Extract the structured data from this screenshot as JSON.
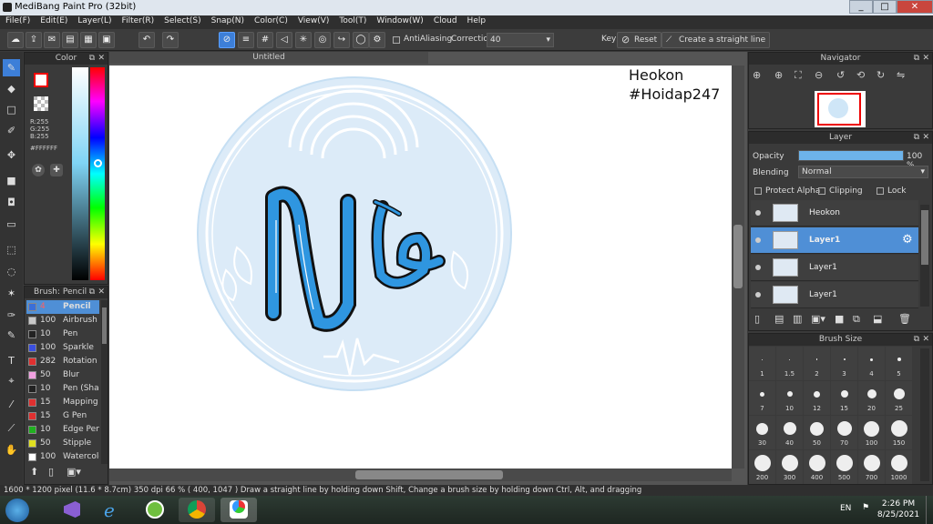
{
  "window": {
    "title": "MediBang Paint Pro (32bit)",
    "min": "_",
    "max": "□",
    "close": "✕"
  },
  "menu": [
    "File(F)",
    "Edit(E)",
    "Layer(L)",
    "Filter(R)",
    "Select(S)",
    "Snap(N)",
    "Color(C)",
    "View(V)",
    "Tool(T)",
    "Window(W)",
    "Cloud",
    "Help"
  ],
  "toolbar": {
    "antialiasing_label": "AntiAliasing",
    "correction_label": "Correction",
    "correction_value": "40",
    "key_label": "Key",
    "reset_label": "Reset",
    "straight_line_label": "Create a straight line"
  },
  "color_panel": {
    "title": "Color",
    "r": "R:255",
    "g": "G:255",
    "b": "B:255",
    "hex": "#FFFFFF"
  },
  "brush_panel": {
    "title": "Brush: Pencil",
    "items": [
      {
        "size": "4",
        "name": "Pencil",
        "color": "#3a6fd8"
      },
      {
        "size": "100",
        "name": "Airbrush",
        "color": "#c8c8c8"
      },
      {
        "size": "10",
        "name": "Pen",
        "color": "#222222"
      },
      {
        "size": "100",
        "name": "Sparkle",
        "color": "#3a4fe0"
      },
      {
        "size": "282",
        "name": "Rotation",
        "color": "#e03030"
      },
      {
        "size": "50",
        "name": "Blur",
        "color": "#f0a0e0"
      },
      {
        "size": "10",
        "name": "Pen (Sharp)",
        "color": "#222222"
      },
      {
        "size": "15",
        "name": "Mapping",
        "color": "#e03030"
      },
      {
        "size": "15",
        "name": "G Pen",
        "color": "#e03030"
      },
      {
        "size": "10",
        "name": "Edge Pen",
        "color": "#20b020"
      },
      {
        "size": "50",
        "name": "Stipple",
        "color": "#e0e020"
      },
      {
        "size": "100",
        "name": "Watercolor",
        "color": "#ffffff"
      }
    ]
  },
  "document": {
    "tab": "Untitled",
    "text_line1": "Heokon",
    "text_line2": "#Hoidap247"
  },
  "navigator": {
    "title": "Navigator"
  },
  "layer_panel": {
    "title": "Layer",
    "opacity_label": "Opacity",
    "opacity_value": "100 %",
    "blending_label": "Blending",
    "blending_value": "Normal",
    "protect_alpha": "Protect Alpha",
    "clipping": "Clipping",
    "lock": "Lock",
    "layers": [
      {
        "name": "Heokon",
        "selected": false
      },
      {
        "name": "Layer1",
        "selected": true
      },
      {
        "name": "Layer1",
        "selected": false
      },
      {
        "name": "Layer1",
        "selected": false
      }
    ]
  },
  "brush_size_panel": {
    "title": "Brush Size",
    "sizes": [
      "1",
      "1.5",
      "2",
      "3",
      "4",
      "5",
      "7",
      "10",
      "12",
      "15",
      "20",
      "25",
      "30",
      "40",
      "50",
      "70",
      "100",
      "150",
      "200",
      "300",
      "400",
      "500",
      "700",
      "1000"
    ]
  },
  "status": {
    "text": "1600 * 1200 pixel   (11.6 * 8.7cm)   350 dpi   66 %   ( 400, 1047 )   Draw a straight line by holding down Shift, Change a brush size by holding down Ctrl, Alt, and dragging"
  },
  "taskbar": {
    "lang": "EN",
    "time": "2:26 PM",
    "date": "8/25/2021"
  }
}
